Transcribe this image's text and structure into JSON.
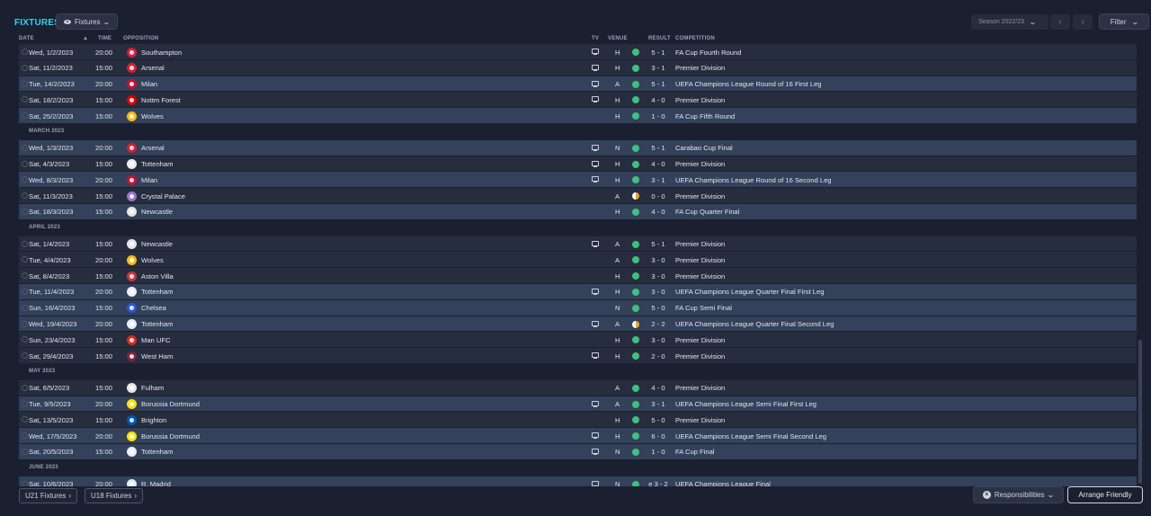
{
  "header": {
    "title": "FIXTURES",
    "view_label": "Fixtures",
    "season_label": "Season 2022/23",
    "filter_label": "Filter"
  },
  "columns": {
    "date": "DATE",
    "time": "TIME",
    "opposition": "OPPOSITION",
    "tv": "TV",
    "venue": "VENUE",
    "result": "RESULT",
    "competition": "COMPETITION"
  },
  "rows": [
    {
      "type": "fixture",
      "date": "Wed, 1/2/2023",
      "time": "20:00",
      "opp": "Southampton",
      "crest": "#d5203a",
      "tv": true,
      "venue": "H",
      "outcome": "win",
      "score": "5 - 1",
      "comp": "FA Cup Fourth Round",
      "hl": false
    },
    {
      "type": "fixture",
      "date": "Sat, 11/2/2023",
      "time": "15:00",
      "opp": "Arsenal",
      "crest": "#d91f2d",
      "tv": true,
      "venue": "H",
      "outcome": "win",
      "score": "3 - 1",
      "comp": "Premier Division",
      "hl": false
    },
    {
      "type": "fixture",
      "date": "Tue, 14/2/2023",
      "time": "20:00",
      "opp": "Milan",
      "crest": "#c8102e",
      "tv": true,
      "venue": "A",
      "outcome": "win",
      "score": "5 - 1",
      "comp": "UEFA Champions League Round of 16  First Leg",
      "hl": true
    },
    {
      "type": "fixture",
      "date": "Sat, 18/2/2023",
      "time": "15:00",
      "opp": "Nottm Forest",
      "crest": "#dd0000",
      "tv": true,
      "venue": "H",
      "outcome": "win",
      "score": "4 - 0",
      "comp": "Premier Division",
      "hl": false
    },
    {
      "type": "fixture",
      "date": "Sat, 25/2/2023",
      "time": "15:00",
      "opp": "Wolves",
      "crest": "#fdb913",
      "tv": false,
      "venue": "H",
      "outcome": "win",
      "score": "1 - 0",
      "comp": "FA Cup Fifth Round",
      "hl": true
    },
    {
      "type": "month",
      "label": "MARCH 2023"
    },
    {
      "type": "fixture",
      "date": "Wed, 1/3/2023",
      "time": "20:00",
      "opp": "Arsenal",
      "crest": "#d91f2d",
      "tv": true,
      "venue": "N",
      "outcome": "win",
      "score": "5 - 1",
      "comp": "Carabao Cup Final",
      "hl": true
    },
    {
      "type": "fixture",
      "date": "Sat, 4/3/2023",
      "time": "15:00",
      "opp": "Tottenham",
      "crest": "#e8ecf3",
      "tv": true,
      "venue": "H",
      "outcome": "win",
      "score": "4 - 0",
      "comp": "Premier Division",
      "hl": false
    },
    {
      "type": "fixture",
      "date": "Wed, 8/3/2023",
      "time": "20:00",
      "opp": "Milan",
      "crest": "#c8102e",
      "tv": true,
      "venue": "H",
      "outcome": "win",
      "score": "3 - 1",
      "comp": "UEFA Champions League Round of 16  Second Leg",
      "hl": true
    },
    {
      "type": "fixture",
      "date": "Sat, 11/3/2023",
      "time": "15:00",
      "opp": "Crystal Palace",
      "crest": "#9b72cf",
      "tv": false,
      "venue": "A",
      "outcome": "draw",
      "score": "0 - 0",
      "comp": "Premier Division",
      "hl": false
    },
    {
      "type": "fixture",
      "date": "Sat, 18/3/2023",
      "time": "15:00",
      "opp": "Newcastle",
      "crest": "#e5e5e5",
      "tv": false,
      "venue": "H",
      "outcome": "win",
      "score": "4 - 0",
      "comp": "FA Cup Quarter Final",
      "hl": true
    },
    {
      "type": "month",
      "label": "APRIL 2023"
    },
    {
      "type": "fixture",
      "date": "Sat, 1/4/2023",
      "time": "15:00",
      "opp": "Newcastle",
      "crest": "#e5e5e5",
      "tv": true,
      "venue": "A",
      "outcome": "win",
      "score": "5 - 1",
      "comp": "Premier Division",
      "hl": false
    },
    {
      "type": "fixture",
      "date": "Tue, 4/4/2023",
      "time": "20:00",
      "opp": "Wolves",
      "crest": "#fdb913",
      "tv": false,
      "venue": "A",
      "outcome": "win",
      "score": "3 - 0",
      "comp": "Premier Division",
      "hl": false
    },
    {
      "type": "fixture",
      "date": "Sat, 8/4/2023",
      "time": "15:00",
      "opp": "Aston Villa",
      "crest": "#c9373b",
      "tv": false,
      "venue": "H",
      "outcome": "win",
      "score": "3 - 0",
      "comp": "Premier Division",
      "hl": false
    },
    {
      "type": "fixture",
      "date": "Tue, 11/4/2023",
      "time": "20:00",
      "opp": "Tottenham",
      "crest": "#e8ecf3",
      "tv": true,
      "venue": "H",
      "outcome": "win",
      "score": "3 - 0",
      "comp": "UEFA Champions League Quarter Final First Leg",
      "hl": true
    },
    {
      "type": "fixture",
      "date": "Sun, 16/4/2023",
      "time": "15:00",
      "opp": "Chelsea",
      "crest": "#2a56d6",
      "tv": false,
      "venue": "N",
      "outcome": "win",
      "score": "5 - 0",
      "comp": "FA Cup Semi Final",
      "hl": true
    },
    {
      "type": "fixture",
      "date": "Wed, 19/4/2023",
      "time": "20:00",
      "opp": "Tottenham",
      "crest": "#e8ecf3",
      "tv": true,
      "venue": "A",
      "outcome": "draw",
      "score": "2 - 2",
      "comp": "UEFA Champions League Quarter Final Second Leg",
      "hl": true
    },
    {
      "type": "fixture",
      "date": "Sun, 23/4/2023",
      "time": "15:00",
      "opp": "Man UFC",
      "crest": "#da291c",
      "tv": false,
      "venue": "H",
      "outcome": "win",
      "score": "3 - 0",
      "comp": "Premier Division",
      "hl": false
    },
    {
      "type": "fixture",
      "date": "Sat, 29/4/2023",
      "time": "15:00",
      "opp": "West Ham",
      "crest": "#7a263a",
      "tv": true,
      "venue": "H",
      "outcome": "win",
      "score": "2 - 0",
      "comp": "Premier Division",
      "hl": false
    },
    {
      "type": "month",
      "label": "MAY 2023"
    },
    {
      "type": "fixture",
      "date": "Sat, 6/5/2023",
      "time": "15:00",
      "opp": "Fulham",
      "crest": "#e6e6e6",
      "tv": false,
      "venue": "A",
      "outcome": "win",
      "score": "4 - 0",
      "comp": "Premier Division",
      "hl": false
    },
    {
      "type": "fixture",
      "date": "Tue, 9/5/2023",
      "time": "20:00",
      "opp": "Borussia Dortmund",
      "crest": "#fde100",
      "tv": true,
      "venue": "A",
      "outcome": "win",
      "score": "3 - 1",
      "comp": "UEFA Champions League Semi Final First Leg",
      "hl": true
    },
    {
      "type": "fixture",
      "date": "Sat, 13/5/2023",
      "time": "15:00",
      "opp": "Brighton",
      "crest": "#0057b8",
      "tv": false,
      "venue": "H",
      "outcome": "win",
      "score": "5 - 0",
      "comp": "Premier Division",
      "hl": false
    },
    {
      "type": "fixture",
      "date": "Wed, 17/5/2023",
      "time": "20:00",
      "opp": "Borussia Dortmund",
      "crest": "#fde100",
      "tv": true,
      "venue": "H",
      "outcome": "win",
      "score": "6 - 0",
      "comp": "UEFA Champions League Semi Final Second Leg",
      "hl": true
    },
    {
      "type": "fixture",
      "date": "Sat, 20/5/2023",
      "time": "15:00",
      "opp": "Tottenham",
      "crest": "#e8ecf3",
      "tv": true,
      "venue": "N",
      "outcome": "win",
      "score": "1 - 0",
      "comp": "FA Cup Final",
      "hl": true
    },
    {
      "type": "month",
      "label": "JUNE 2023"
    },
    {
      "type": "fixture",
      "date": "Sat, 10/6/2023",
      "time": "20:00",
      "opp": "R. Madrid",
      "crest": "#e4e8f0",
      "tv": true,
      "venue": "N",
      "outcome": "win",
      "score": "e 3 - 2",
      "comp": "UEFA Champions League Final",
      "hl": true
    }
  ],
  "footer": {
    "u21_label": "U21 Fixtures",
    "u18_label": "U18 Fixtures",
    "responsibilities_label": "Responsibilities",
    "arrange_label": "Arrange Friendly"
  },
  "colors": {
    "accent": "#3ad0f0",
    "win": "#3fbf7f",
    "draw": "#e8a42b"
  }
}
